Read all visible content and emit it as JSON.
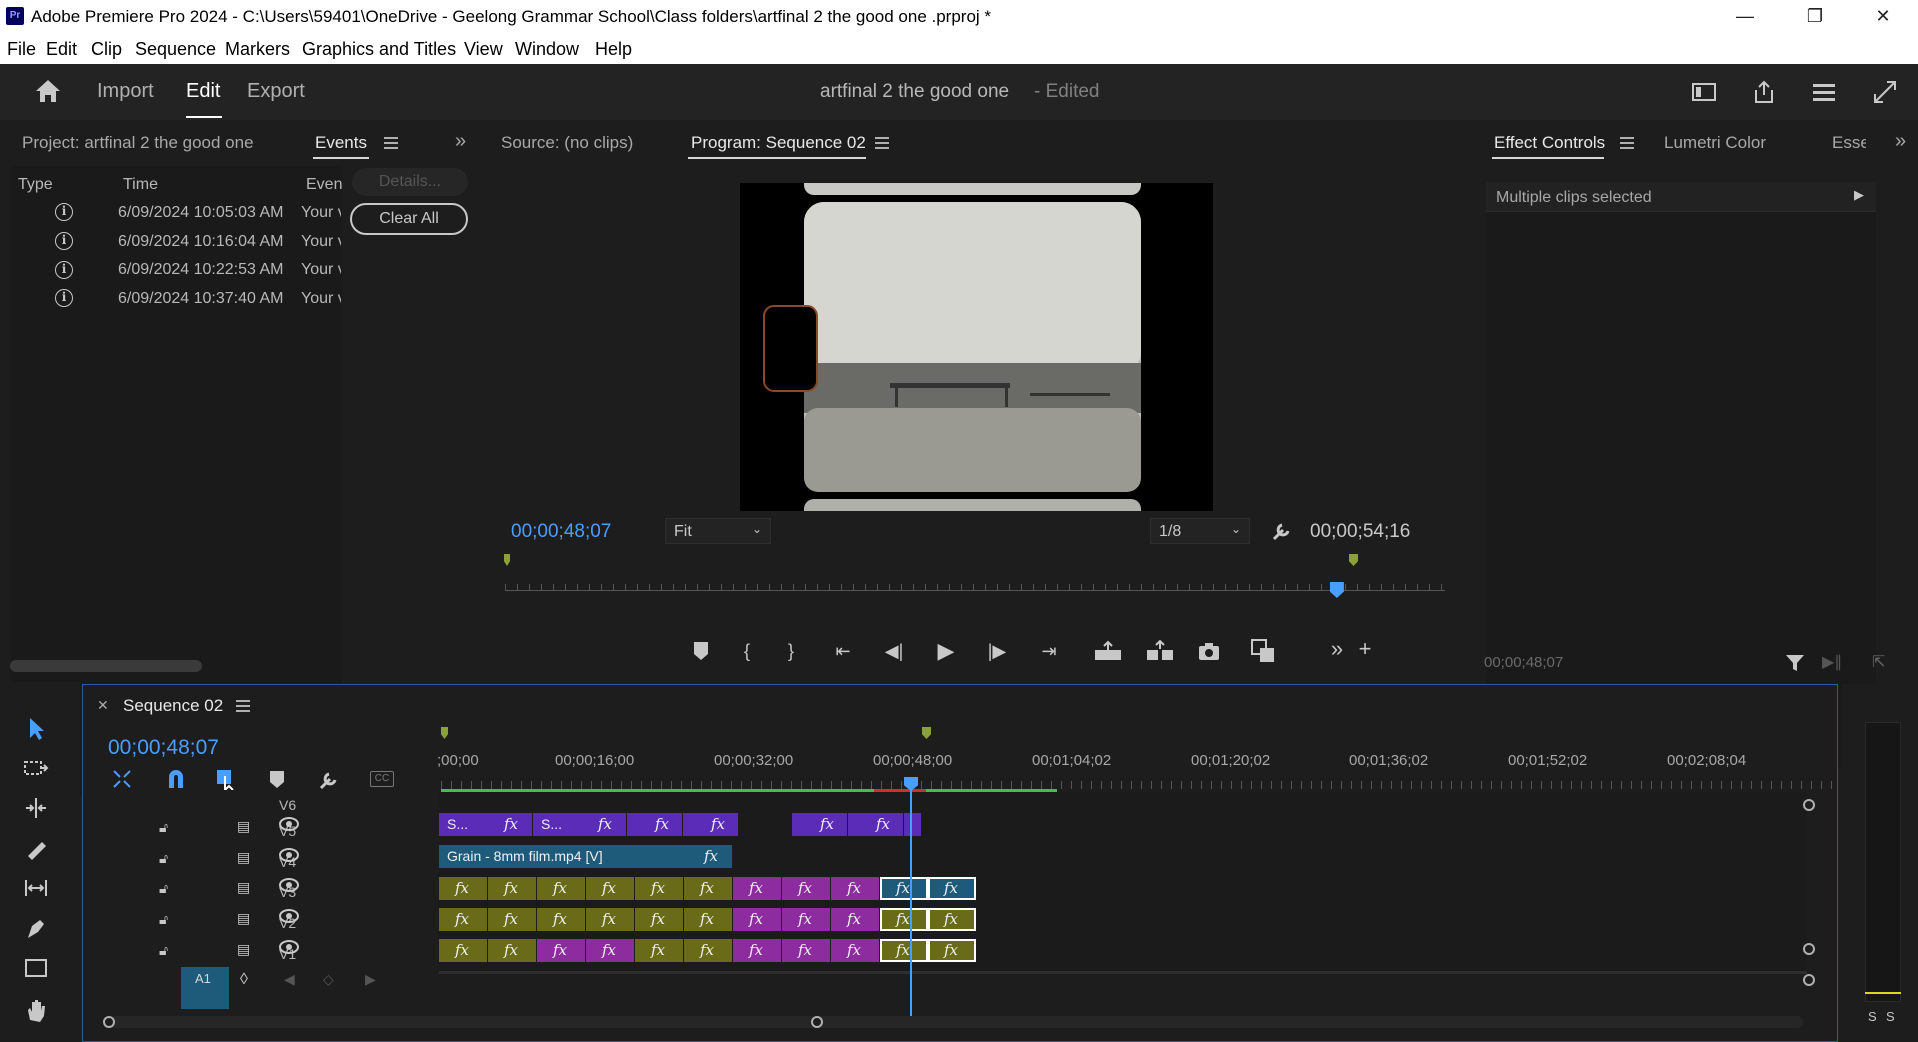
{
  "window": {
    "app_icon": "Pr",
    "title": "Adobe Premiere Pro 2024 - C:\\Users\\59401\\OneDrive - Geelong Grammar School\\Class folders\\artfinal 2 the good one .prproj *",
    "minimize_icon": "minimize-icon",
    "restore_icon": "restore-icon",
    "close_icon": "close-icon"
  },
  "menu": [
    "File",
    "Edit",
    "Clip",
    "Sequence",
    "Markers",
    "Graphics and Titles",
    "View",
    "Window",
    "Help"
  ],
  "header": {
    "tabs": [
      "Import",
      "Edit",
      "Export"
    ],
    "active_tab": "Edit",
    "project_name": "artfinal 2 the good one",
    "status": "- Edited"
  },
  "project_panel": {
    "title": "Project: artfinal 2 the good one",
    "events_tab": "Events",
    "columns": [
      "Type",
      "Time",
      "Even"
    ],
    "details_button": "Details...",
    "clear_all_button": "Clear All",
    "events": [
      {
        "time": "6/09/2024 10:05:03 AM",
        "text": "Your v"
      },
      {
        "time": "6/09/2024 10:16:04 AM",
        "text": "Your v"
      },
      {
        "time": "6/09/2024 10:22:53 AM",
        "text": "Your v"
      },
      {
        "time": "6/09/2024 10:37:40 AM",
        "text": "Your v"
      }
    ]
  },
  "monitor": {
    "source_tab": "Source: (no clips)",
    "program_tab": "Program: Sequence 02",
    "current_timecode": "00;00;48;07",
    "fit": "Fit",
    "resolution": "1/8",
    "duration_timecode": "00;00;54;16",
    "playhead_fraction": 0.885
  },
  "effect_controls": {
    "tab": "Effect Controls",
    "lumetri_tab": "Lumetri Color",
    "ess_tab": "Esse",
    "message": "Multiple clips selected",
    "timecode": "00;00;48;07"
  },
  "timeline": {
    "sequence_tab": "Sequence 02",
    "timecode": "00;00;48;07",
    "ruler_labels": [
      ";00;00",
      "00;00;16;00",
      "00;00;32;00",
      "00;00;48;00",
      "00;01;04;02",
      "00;01;20;02",
      "00;01;36;02",
      "00;01;52;02",
      "00;02;08;04"
    ],
    "tracks": [
      "V6",
      "V5",
      "V4",
      "V3",
      "V2",
      "V1",
      "A1"
    ],
    "grain_clip": "Grain - 8mm film.mp4 [V]",
    "clip_fx": "fx",
    "clip_s": "S...",
    "audio_meter_labels": [
      "S",
      "S"
    ]
  },
  "colors": {
    "accent_blue": "#4a9eff",
    "olive_clip": "#6a6b18",
    "magenta_clip": "#8c2c9e",
    "purple_clip": "#5a2cb8",
    "teal_clip": "#1e5a7a"
  }
}
